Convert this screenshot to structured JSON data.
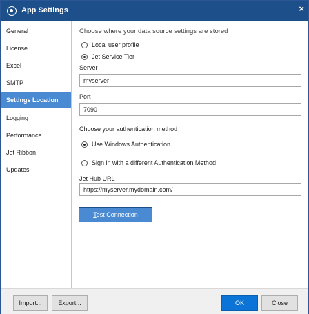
{
  "window": {
    "title": "App Settings",
    "close_glyph": "×"
  },
  "sidebar": {
    "items": [
      {
        "label": "General"
      },
      {
        "label": "License"
      },
      {
        "label": "Excel"
      },
      {
        "label": "SMTP"
      },
      {
        "label": "Settings Location",
        "active": true
      },
      {
        "label": "Logging"
      },
      {
        "label": "Performance"
      },
      {
        "label": "Jet Ribbon"
      },
      {
        "label": "Updates"
      }
    ]
  },
  "main": {
    "heading": "Choose where your data source settings are stored",
    "location_options": [
      {
        "label": "Local user profile",
        "checked": false
      },
      {
        "label": "Jet Service Tier",
        "checked": true
      }
    ],
    "server": {
      "label": "Server",
      "value": "myserver"
    },
    "port": {
      "label": "Port",
      "value": "7090"
    },
    "auth_heading": "Choose your authentication method",
    "auth_options": [
      {
        "label": "Use Windows Authentication",
        "checked": true
      },
      {
        "label": "Sign in with a different Authentication Method",
        "checked": false
      }
    ],
    "hub_url": {
      "label": "Jet Hub URL",
      "value": "https://myserver.mydomain.com/"
    },
    "test_button": {
      "mnemonic": "T",
      "rest": "est Connection"
    }
  },
  "footer": {
    "import_label": "Import...",
    "export_label": "Export...",
    "ok": {
      "mnemonic": "O",
      "rest": "K"
    },
    "close_label": "Close"
  },
  "colors": {
    "titlebar": "#1d4f8a",
    "accent": "#4a8ad2",
    "primary_button": "#0b74d6"
  },
  "icons": {
    "title": "app-settings-icon",
    "close": "close-icon"
  }
}
